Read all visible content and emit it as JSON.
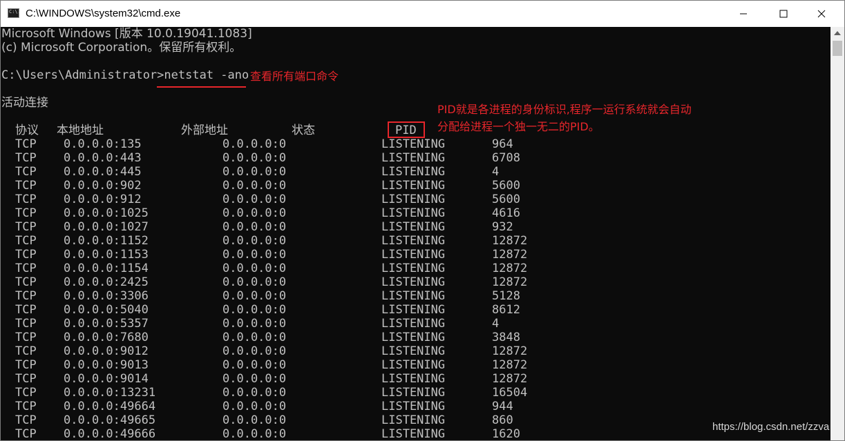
{
  "window": {
    "title": "C:\\WINDOWS\\system32\\cmd.exe",
    "icon_text": "C:\\."
  },
  "console": {
    "banner_line1": "Microsoft Windows [版本 10.0.19041.1083]",
    "banner_line2": "(c) Microsoft Corporation。保留所有权利。",
    "prompt": "C:\\Users\\Administrator>",
    "command": "netstat -ano",
    "section_title": "活动连接",
    "headers": {
      "proto": "协议",
      "local": "本地地址",
      "foreign": "外部地址",
      "state": "状态",
      "pid": "PID"
    },
    "rows": [
      {
        "proto": "TCP",
        "local": "0.0.0.0:135",
        "foreign": "0.0.0.0:0",
        "state": "LISTENING",
        "pid": "964"
      },
      {
        "proto": "TCP",
        "local": "0.0.0.0:443",
        "foreign": "0.0.0.0:0",
        "state": "LISTENING",
        "pid": "6708"
      },
      {
        "proto": "TCP",
        "local": "0.0.0.0:445",
        "foreign": "0.0.0.0:0",
        "state": "LISTENING",
        "pid": "4"
      },
      {
        "proto": "TCP",
        "local": "0.0.0.0:902",
        "foreign": "0.0.0.0:0",
        "state": "LISTENING",
        "pid": "5600"
      },
      {
        "proto": "TCP",
        "local": "0.0.0.0:912",
        "foreign": "0.0.0.0:0",
        "state": "LISTENING",
        "pid": "5600"
      },
      {
        "proto": "TCP",
        "local": "0.0.0.0:1025",
        "foreign": "0.0.0.0:0",
        "state": "LISTENING",
        "pid": "4616"
      },
      {
        "proto": "TCP",
        "local": "0.0.0.0:1027",
        "foreign": "0.0.0.0:0",
        "state": "LISTENING",
        "pid": "932"
      },
      {
        "proto": "TCP",
        "local": "0.0.0.0:1152",
        "foreign": "0.0.0.0:0",
        "state": "LISTENING",
        "pid": "12872"
      },
      {
        "proto": "TCP",
        "local": "0.0.0.0:1153",
        "foreign": "0.0.0.0:0",
        "state": "LISTENING",
        "pid": "12872"
      },
      {
        "proto": "TCP",
        "local": "0.0.0.0:1154",
        "foreign": "0.0.0.0:0",
        "state": "LISTENING",
        "pid": "12872"
      },
      {
        "proto": "TCP",
        "local": "0.0.0.0:2425",
        "foreign": "0.0.0.0:0",
        "state": "LISTENING",
        "pid": "12872"
      },
      {
        "proto": "TCP",
        "local": "0.0.0.0:3306",
        "foreign": "0.0.0.0:0",
        "state": "LISTENING",
        "pid": "5128"
      },
      {
        "proto": "TCP",
        "local": "0.0.0.0:5040",
        "foreign": "0.0.0.0:0",
        "state": "LISTENING",
        "pid": "8612"
      },
      {
        "proto": "TCP",
        "local": "0.0.0.0:5357",
        "foreign": "0.0.0.0:0",
        "state": "LISTENING",
        "pid": "4"
      },
      {
        "proto": "TCP",
        "local": "0.0.0.0:7680",
        "foreign": "0.0.0.0:0",
        "state": "LISTENING",
        "pid": "3848"
      },
      {
        "proto": "TCP",
        "local": "0.0.0.0:9012",
        "foreign": "0.0.0.0:0",
        "state": "LISTENING",
        "pid": "12872"
      },
      {
        "proto": "TCP",
        "local": "0.0.0.0:9013",
        "foreign": "0.0.0.0:0",
        "state": "LISTENING",
        "pid": "12872"
      },
      {
        "proto": "TCP",
        "local": "0.0.0.0:9014",
        "foreign": "0.0.0.0:0",
        "state": "LISTENING",
        "pid": "12872"
      },
      {
        "proto": "TCP",
        "local": "0.0.0.0:13231",
        "foreign": "0.0.0.0:0",
        "state": "LISTENING",
        "pid": "16504"
      },
      {
        "proto": "TCP",
        "local": "0.0.0.0:49664",
        "foreign": "0.0.0.0:0",
        "state": "LISTENING",
        "pid": "944"
      },
      {
        "proto": "TCP",
        "local": "0.0.0.0:49665",
        "foreign": "0.0.0.0:0",
        "state": "LISTENING",
        "pid": "860"
      },
      {
        "proto": "TCP",
        "local": "0.0.0.0:49666",
        "foreign": "0.0.0.0:0",
        "state": "LISTENING",
        "pid": "1620"
      }
    ]
  },
  "annotations": {
    "command_note": "查看所有端口命令",
    "pid_note_line1": "PID就是各进程的身份标识,程序一运行系统就会自动",
    "pid_note_line2": "分配给进程一个独一无二的PID。"
  },
  "watermark": "https://blog.csdn.net/zzva",
  "colors": {
    "console_bg": "#0c0c0c",
    "console_fg": "#c0c0c0",
    "annotation": "#e8262b",
    "titlebar_bg": "#ffffff"
  },
  "icons": {
    "app": "cmd-icon",
    "minimize": "minimize-icon",
    "maximize": "maximize-icon",
    "close": "close-icon",
    "scroll_up": "scroll-up-arrow-icon"
  }
}
